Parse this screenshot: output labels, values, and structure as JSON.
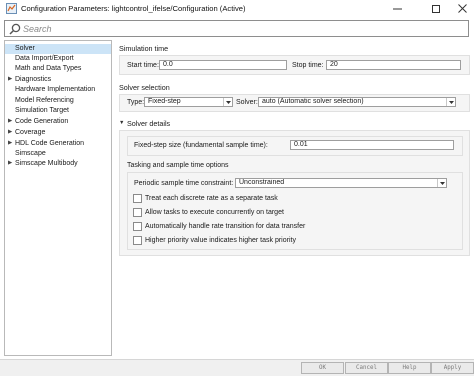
{
  "window": {
    "title": "Configuration Parameters: lightcontrol_ifelse/Configuration (Active)",
    "controls": [
      "minimize-icon",
      "maximize-icon",
      "close-icon"
    ]
  },
  "search": {
    "placeholder": "Search"
  },
  "tree": [
    {
      "label": "Solver",
      "expandable": false,
      "selected": true
    },
    {
      "label": "Data Import/Export",
      "expandable": false
    },
    {
      "label": "Math and Data Types",
      "expandable": false
    },
    {
      "label": "Diagnostics",
      "expandable": true
    },
    {
      "label": "Hardware Implementation",
      "expandable": false
    },
    {
      "label": "Model Referencing",
      "expandable": false
    },
    {
      "label": "Simulation Target",
      "expandable": false
    },
    {
      "label": "Code Generation",
      "expandable": true
    },
    {
      "label": "Coverage",
      "expandable": true
    },
    {
      "label": "HDL Code Generation",
      "expandable": true
    },
    {
      "label": "Simscape",
      "expandable": false
    },
    {
      "label": "Simscape Multibody",
      "expandable": true
    }
  ],
  "simulation_time": {
    "heading": "Simulation time",
    "start_label": "Start time:",
    "start_value": "0.0",
    "stop_label": "Stop time:",
    "stop_value": "20"
  },
  "solver_selection": {
    "heading": "Solver selection",
    "type_label": "Type:",
    "type_value": "Fixed-step",
    "solver_label": "Solver:",
    "solver_value": "auto (Automatic solver selection)"
  },
  "solver_details": {
    "heading": "Solver details",
    "fixed_step_label": "Fixed-step size (fundamental sample time):",
    "fixed_step_value": "0.01"
  },
  "tasking": {
    "heading": "Tasking and sample time options",
    "constraint_label": "Periodic sample time constraint:",
    "constraint_value": "Unconstrained",
    "options": [
      {
        "label": "Treat each discrete rate as a separate task",
        "checked": false
      },
      {
        "label": "Allow tasks to execute concurrently on target",
        "checked": false
      },
      {
        "label": "Automatically handle rate transition for data transfer",
        "checked": false
      },
      {
        "label": "Higher priority value indicates higher task priority",
        "checked": false
      }
    ]
  },
  "buttons": {
    "ok": "OK",
    "cancel": "Cancel",
    "help": "Help",
    "apply": "Apply"
  },
  "colors": {
    "selection": "#cce4f7",
    "panel": "#f5f5f5"
  }
}
